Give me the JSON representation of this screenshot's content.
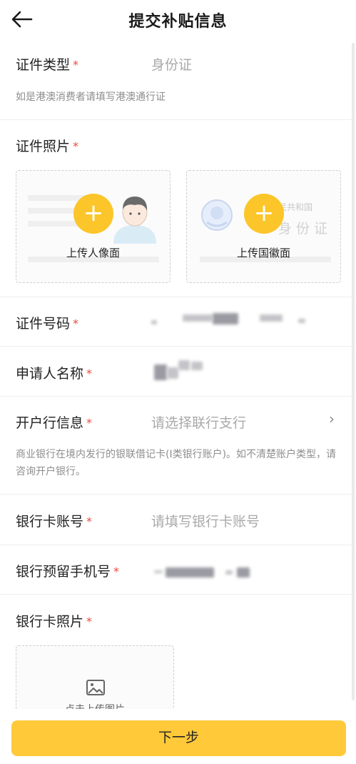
{
  "header": {
    "title": "提交补贴信息"
  },
  "id_type": {
    "label": "证件类型",
    "required_mark": "*",
    "value": "身份证",
    "hint": "如是港澳消费者请填写港澳通行证"
  },
  "id_photo": {
    "label": "证件照片",
    "required_mark": "*",
    "front": {
      "caption": "上传人像面",
      "plus": "+"
    },
    "back": {
      "caption": "上传国徽面",
      "plus": "+",
      "card_header": "民共和国",
      "card_title": "身份证"
    }
  },
  "id_number": {
    "label": "证件号码",
    "required_mark": "*"
  },
  "applicant_name": {
    "label": "申请人名称",
    "required_mark": "*"
  },
  "bank_info": {
    "label": "开户行信息",
    "required_mark": "*",
    "placeholder": "请选择联行支行",
    "chevron": "›",
    "hint": "商业银行在境内发行的银联借记卡(I类银行账户)。如不清楚账户类型，请咨询开户银行。"
  },
  "bank_card_number": {
    "label": "银行卡账号",
    "required_mark": "*",
    "placeholder": "请填写银行卡账号"
  },
  "bank_phone": {
    "label": "银行预留手机号",
    "required_mark": "*"
  },
  "bank_card_photo": {
    "label": "银行卡照片",
    "required_mark": "*",
    "caption": "点击上传图片"
  },
  "footer": {
    "next_label": "下一步"
  },
  "colors": {
    "accent": "#ffc93a",
    "required": "#f0483e",
    "placeholder": "#a9a9a9"
  }
}
